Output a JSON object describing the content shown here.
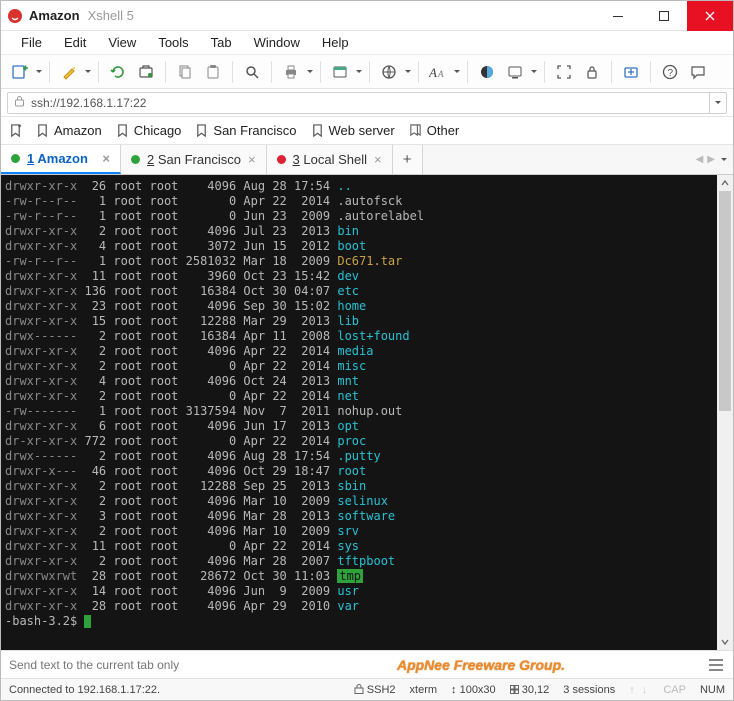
{
  "titlebar": {
    "title": "Amazon",
    "subtitle": "Xshell 5"
  },
  "menu": {
    "file": "File",
    "edit": "Edit",
    "view": "View",
    "tools": "Tools",
    "tab": "Tab",
    "window": "Window",
    "help": "Help"
  },
  "address": {
    "value": "ssh://192.168.1.17:22"
  },
  "bookmarks": {
    "b0": "Amazon",
    "b1": "Chicago",
    "b2": "San Francisco",
    "b3": "Web server",
    "b4": "Other"
  },
  "tabs": {
    "t0": {
      "num": "1",
      "label": "Amazon"
    },
    "t1": {
      "num": "2",
      "label": "San Francisco"
    },
    "t2": {
      "num": "3",
      "label": "Local Shell"
    },
    "newtab": "+"
  },
  "terminal": {
    "prompt": "-bash-3.2$ ",
    "rows": [
      {
        "perm": "drwxr-xr-x",
        "lnk": "26",
        "own": "root",
        "grp": "root",
        "size": "4096",
        "date": "Aug 28 17:54",
        "name": "..",
        "cls": "cyan"
      },
      {
        "perm": "-rw-r--r--",
        "lnk": "1",
        "own": "root",
        "grp": "root",
        "size": "0",
        "date": "Apr 22  2014",
        "name": ".autofsck",
        "cls": ""
      },
      {
        "perm": "-rw-r--r--",
        "lnk": "1",
        "own": "root",
        "grp": "root",
        "size": "0",
        "date": "Jun 23  2009",
        "name": ".autorelabel",
        "cls": ""
      },
      {
        "perm": "drwxr-xr-x",
        "lnk": "2",
        "own": "root",
        "grp": "root",
        "size": "4096",
        "date": "Jul 23  2013",
        "name": "bin",
        "cls": "cyan"
      },
      {
        "perm": "drwxr-xr-x",
        "lnk": "4",
        "own": "root",
        "grp": "root",
        "size": "3072",
        "date": "Jun 15  2012",
        "name": "boot",
        "cls": "cyan"
      },
      {
        "perm": "-rw-r--r--",
        "lnk": "1",
        "own": "root",
        "grp": "root",
        "size": "2581032",
        "date": "Mar 18  2009",
        "name": "Dc671.tar",
        "cls": "yellow"
      },
      {
        "perm": "drwxr-xr-x",
        "lnk": "11",
        "own": "root",
        "grp": "root",
        "size": "3960",
        "date": "Oct 23 15:42",
        "name": "dev",
        "cls": "cyan"
      },
      {
        "perm": "drwxr-xr-x",
        "lnk": "136",
        "own": "root",
        "grp": "root",
        "size": "16384",
        "date": "Oct 30 04:07",
        "name": "etc",
        "cls": "cyan"
      },
      {
        "perm": "drwxr-xr-x",
        "lnk": "23",
        "own": "root",
        "grp": "root",
        "size": "4096",
        "date": "Sep 30 15:02",
        "name": "home",
        "cls": "cyan"
      },
      {
        "perm": "drwxr-xr-x",
        "lnk": "15",
        "own": "root",
        "grp": "root",
        "size": "12288",
        "date": "Mar 29  2013",
        "name": "lib",
        "cls": "cyan"
      },
      {
        "perm": "drwx------",
        "lnk": "2",
        "own": "root",
        "grp": "root",
        "size": "16384",
        "date": "Apr 11  2008",
        "name": "lost+found",
        "cls": "cyan"
      },
      {
        "perm": "drwxr-xr-x",
        "lnk": "2",
        "own": "root",
        "grp": "root",
        "size": "4096",
        "date": "Apr 22  2014",
        "name": "media",
        "cls": "cyan"
      },
      {
        "perm": "drwxr-xr-x",
        "lnk": "2",
        "own": "root",
        "grp": "root",
        "size": "0",
        "date": "Apr 22  2014",
        "name": "misc",
        "cls": "cyan"
      },
      {
        "perm": "drwxr-xr-x",
        "lnk": "4",
        "own": "root",
        "grp": "root",
        "size": "4096",
        "date": "Oct 24  2013",
        "name": "mnt",
        "cls": "cyan"
      },
      {
        "perm": "drwxr-xr-x",
        "lnk": "2",
        "own": "root",
        "grp": "root",
        "size": "0",
        "date": "Apr 22  2014",
        "name": "net",
        "cls": "cyan"
      },
      {
        "perm": "-rw-------",
        "lnk": "1",
        "own": "root",
        "grp": "root",
        "size": "3137594",
        "date": "Nov  7  2011",
        "name": "nohup.out",
        "cls": ""
      },
      {
        "perm": "drwxr-xr-x",
        "lnk": "6",
        "own": "root",
        "grp": "root",
        "size": "4096",
        "date": "Jun 17  2013",
        "name": "opt",
        "cls": "cyan"
      },
      {
        "perm": "dr-xr-xr-x",
        "lnk": "772",
        "own": "root",
        "grp": "root",
        "size": "0",
        "date": "Apr 22  2014",
        "name": "proc",
        "cls": "cyan"
      },
      {
        "perm": "drwx------",
        "lnk": "2",
        "own": "root",
        "grp": "root",
        "size": "4096",
        "date": "Aug 28 17:54",
        "name": ".putty",
        "cls": "cyan"
      },
      {
        "perm": "drwxr-x---",
        "lnk": "46",
        "own": "root",
        "grp": "root",
        "size": "4096",
        "date": "Oct 29 18:47",
        "name": "root",
        "cls": "cyan"
      },
      {
        "perm": "drwxr-xr-x",
        "lnk": "2",
        "own": "root",
        "grp": "root",
        "size": "12288",
        "date": "Sep 25  2013",
        "name": "sbin",
        "cls": "cyan"
      },
      {
        "perm": "drwxr-xr-x",
        "lnk": "2",
        "own": "root",
        "grp": "root",
        "size": "4096",
        "date": "Mar 10  2009",
        "name": "selinux",
        "cls": "cyan"
      },
      {
        "perm": "drwxr-xr-x",
        "lnk": "3",
        "own": "root",
        "grp": "root",
        "size": "4096",
        "date": "Mar 28  2013",
        "name": "software",
        "cls": "cyan"
      },
      {
        "perm": "drwxr-xr-x",
        "lnk": "2",
        "own": "root",
        "grp": "root",
        "size": "4096",
        "date": "Mar 10  2009",
        "name": "srv",
        "cls": "cyan"
      },
      {
        "perm": "drwxr-xr-x",
        "lnk": "11",
        "own": "root",
        "grp": "root",
        "size": "0",
        "date": "Apr 22  2014",
        "name": "sys",
        "cls": "cyan"
      },
      {
        "perm": "drwxr-xr-x",
        "lnk": "2",
        "own": "root",
        "grp": "root",
        "size": "4096",
        "date": "Mar 28  2007",
        "name": "tftpboot",
        "cls": "cyan"
      },
      {
        "perm": "drwxrwxrwt",
        "lnk": "28",
        "own": "root",
        "grp": "root",
        "size": "28672",
        "date": "Oct 30 11:03",
        "name": "tmp",
        "cls": "bgreen"
      },
      {
        "perm": "drwxr-xr-x",
        "lnk": "14",
        "own": "root",
        "grp": "root",
        "size": "4096",
        "date": "Jun  9  2009",
        "name": "usr",
        "cls": "cyan"
      },
      {
        "perm": "drwxr-xr-x",
        "lnk": "28",
        "own": "root",
        "grp": "root",
        "size": "4096",
        "date": "Apr 29  2010",
        "name": "var",
        "cls": "cyan"
      }
    ]
  },
  "bottominput": {
    "placeholder": "Send text to the current tab only",
    "watermark": "AppNee Freeware Group."
  },
  "status": {
    "connected": "Connected to 192.168.1.17:22.",
    "proto": "SSH2",
    "termtype": "xterm",
    "size": "100x30",
    "pos": "30,12",
    "sessions": "3 sessions",
    "cap": "CAP",
    "num": "NUM"
  }
}
